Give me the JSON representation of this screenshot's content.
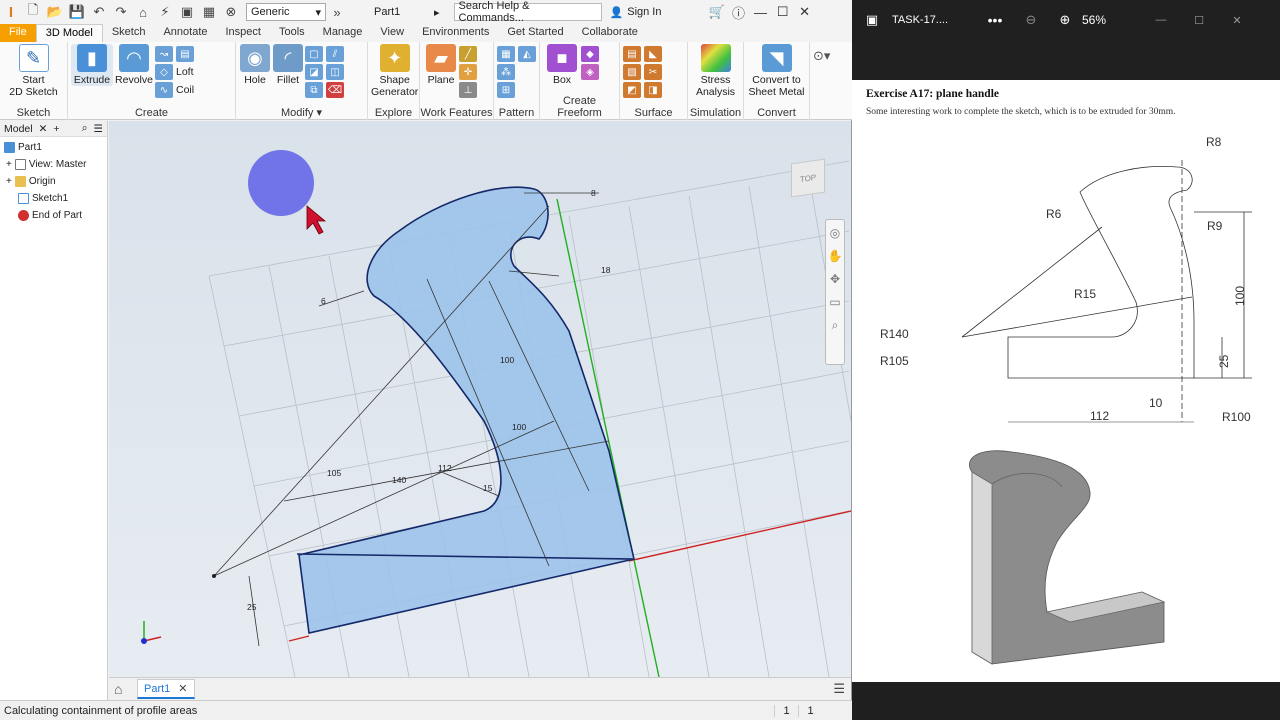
{
  "titlebar": {
    "appearance": "Generic",
    "document": "Part1",
    "search_placeholder": "Search Help & Commands...",
    "signin": "Sign In"
  },
  "tabs": [
    {
      "label": "File"
    },
    {
      "label": "3D Model"
    },
    {
      "label": "Sketch"
    },
    {
      "label": "Annotate"
    },
    {
      "label": "Inspect"
    },
    {
      "label": "Tools"
    },
    {
      "label": "Manage"
    },
    {
      "label": "View"
    },
    {
      "label": "Environments"
    },
    {
      "label": "Get Started"
    },
    {
      "label": "Collaborate"
    }
  ],
  "ribbon": {
    "start_sketch": "Start\n2D Sketch",
    "sketch_panel": "Sketch",
    "extrude": "Extrude",
    "revolve": "Revolve",
    "loft": "Loft",
    "coil": "Coil",
    "create_panel": "Create",
    "hole": "Hole",
    "fillet": "Fillet",
    "modify_panel": "Modify",
    "shape_generator": "Shape\nGenerator",
    "explore_panel": "Explore",
    "plane": "Plane",
    "work_features_panel": "Work Features",
    "pattern_panel": "Pattern",
    "box": "Box",
    "freeform_panel": "Create Freeform",
    "surface_panel": "Surface",
    "stress_analysis": "Stress\nAnalysis",
    "simulation_panel": "Simulation",
    "convert_sheet_metal": "Convert to\nSheet Metal",
    "convert_panel": "Convert"
  },
  "browser": {
    "header": "Model",
    "items": [
      {
        "label": "Part1"
      },
      {
        "label": "View: Master"
      },
      {
        "label": "Origin"
      },
      {
        "label": "Sketch1"
      },
      {
        "label": "End of Part"
      }
    ]
  },
  "viewport": {
    "viewcube_label": "TOP",
    "dims": {
      "d8": "8",
      "d18": "18",
      "d6": "6",
      "d100a": "100",
      "d100b": "100",
      "d105": "105",
      "d140": "140",
      "d112": "112",
      "d15": "15",
      "d25": "25"
    }
  },
  "doc_tab": "Part1",
  "status": {
    "message": "Calculating containment of profile areas",
    "num1": "1",
    "num2": "1"
  },
  "pdf": {
    "filename": "TASK-17....",
    "zoom": "56%",
    "title": "Exercise A17: plane handle",
    "description": "Some interesting work to complete the sketch, which is to be extruded for 30mm.",
    "labels": {
      "r8": "R8",
      "r6": "R6",
      "r9": "R9",
      "r15": "R15",
      "r140": "R140",
      "r105": "R105",
      "r100": "R100",
      "d100": "100",
      "d25": "25",
      "d10": "10",
      "d112": "112"
    }
  }
}
